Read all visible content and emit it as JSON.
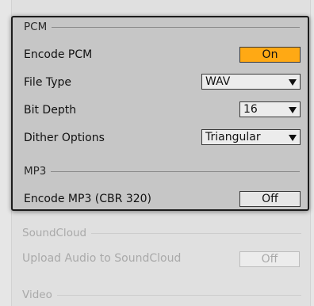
{
  "pcm": {
    "header": "PCM",
    "encode_label": "Encode PCM",
    "encode_value": "On",
    "file_type_label": "File Type",
    "file_type_value": "WAV",
    "bit_depth_label": "Bit Depth",
    "bit_depth_value": "16",
    "dither_label": "Dither Options",
    "dither_value": "Triangular"
  },
  "mp3": {
    "header": "MP3",
    "encode_label": "Encode MP3 (CBR 320)",
    "encode_value": "Off"
  },
  "soundcloud": {
    "header": "SoundCloud",
    "upload_label": "Upload Audio to SoundCloud",
    "upload_value": "Off"
  },
  "video": {
    "header": "Video"
  },
  "colors": {
    "toggle_on": "#ffa914",
    "panel_bg": "#c6c6c6",
    "page_bg": "#e6e6e6"
  }
}
